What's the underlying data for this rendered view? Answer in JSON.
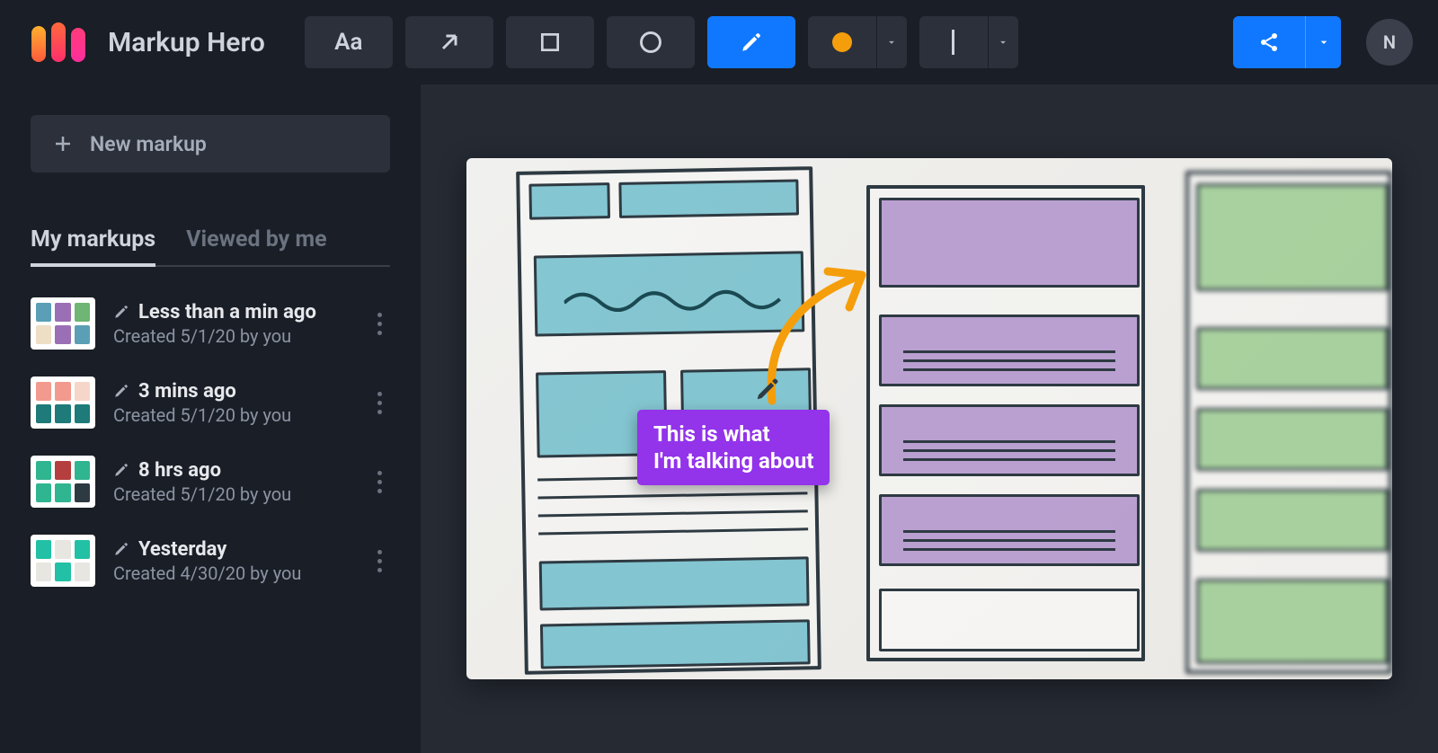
{
  "app": {
    "title": "Markup Hero",
    "avatar_initial": "N"
  },
  "toolbar": {
    "text_label": "Aa",
    "tools": [
      "text",
      "arrow",
      "rectangle",
      "circle",
      "pen"
    ],
    "active_tool": "pen",
    "color": "#f59e0b",
    "color_name": "orange",
    "stroke": "thin"
  },
  "sidebar": {
    "new_markup_label": "New markup",
    "tabs": [
      {
        "label": "My markups",
        "active": true
      },
      {
        "label": "Viewed by me",
        "active": false
      }
    ],
    "items": [
      {
        "title": "Less than a min ago",
        "subtitle": "Created 5/1/20 by you",
        "thumb_colors": [
          "#5a9fb5",
          "#9b6fb5",
          "#6fb573",
          "#eedec5",
          "#9b6fb5",
          "#5a9fb5"
        ]
      },
      {
        "title": "3 mins ago",
        "subtitle": "Created 5/1/20 by you",
        "thumb_colors": [
          "#f29a8e",
          "#f29a8e",
          "#f5d6c8",
          "#1f7a7a",
          "#1f7a7a",
          "#1f7a7a"
        ]
      },
      {
        "title": "8 hrs ago",
        "subtitle": "Created 5/1/20 by you",
        "thumb_colors": [
          "#2fb58f",
          "#b53f3f",
          "#2fb58f",
          "#2fb58f",
          "#2fb58f",
          "#2e3a42"
        ]
      },
      {
        "title": "Yesterday",
        "subtitle": "Created 4/30/20 by you",
        "thumb_colors": [
          "#22c0a5",
          "#e8e6e1",
          "#22c0a5",
          "#e8e6e1",
          "#22c0a5",
          "#e8e6e1"
        ]
      }
    ]
  },
  "canvas": {
    "annotation_text": "This is what\nI'm talking about",
    "annotation_color": "#9333ea",
    "arrow_color": "#f59e0b"
  }
}
